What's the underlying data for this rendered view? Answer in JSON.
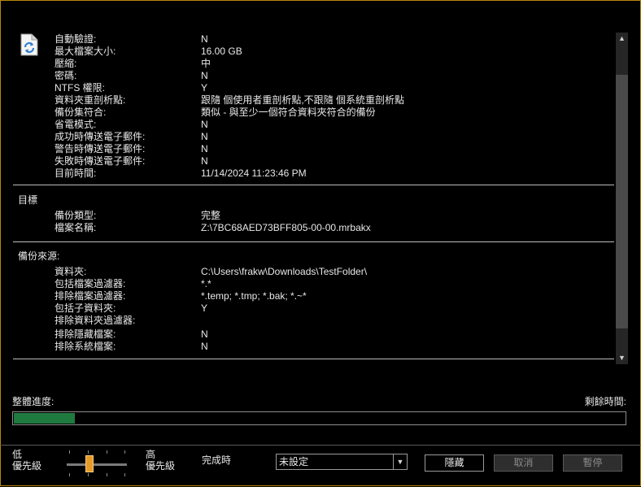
{
  "summary": [
    {
      "k": "自動驗證:",
      "v": "N"
    },
    {
      "k": "最大檔案大小:",
      "v": "16.00 GB"
    },
    {
      "k": "壓縮:",
      "v": "中"
    },
    {
      "k": "密碼:",
      "v": "N"
    },
    {
      "k": "NTFS 權限:",
      "v": "Y"
    },
    {
      "k": "資料夾重剖析點:",
      "v": "跟隨 個使用者重剖析點,不跟隨 個系統重剖析點"
    },
    {
      "k": "備份集符合:",
      "v": "類似 - 與至少一個符合資料夾符合的備份"
    },
    {
      "k": "省電模式:",
      "v": "N"
    },
    {
      "k": "成功時傳送電子郵件:",
      "v": "N"
    },
    {
      "k": "警告時傳送電子郵件:",
      "v": "N"
    },
    {
      "k": "失敗時傳送電子郵件:",
      "v": "N"
    },
    {
      "k": "目前時間:",
      "v": "11/14/2024 11:23:46 PM"
    }
  ],
  "target": {
    "title": "目標",
    "items": [
      {
        "k": "備份類型:",
        "v": "完整"
      },
      {
        "k": "檔案名稱:",
        "v": "Z:\\7BC68AED73BFF805-00-00.mrbakx"
      }
    ]
  },
  "source": {
    "title": "備份來源:",
    "items": [
      {
        "k": "資料夾:",
        "v": "C:\\Users\\frakw\\Downloads\\TestFolder\\"
      },
      {
        "k": "包括檔案過濾器:",
        "v": "*.*"
      },
      {
        "k": "排除檔案過濾器:",
        "v": "*.temp; *.tmp; *.bak; *.~*"
      },
      {
        "k": "包括子資料夾:",
        "v": "Y"
      },
      {
        "k": "排除資料夾過濾器:",
        "v": ""
      },
      {
        "k": "排除隱藏檔案:",
        "v": "N"
      },
      {
        "k": "排除系統檔案:",
        "v": "N"
      }
    ]
  },
  "progress": {
    "overall_label": "整體進度:",
    "remaining_label": "剩餘時間:",
    "fraction": 0.1,
    "fill_color": "#1f7a3f"
  },
  "priority": {
    "low_line1": "低",
    "low_line2": "優先級",
    "high_line1": "高",
    "high_line2": "優先級",
    "level_fraction": 0.36,
    "thumb_color": "#e59b2a"
  },
  "completion": {
    "label": "完成時",
    "selected": "未設定"
  },
  "buttons": {
    "hide": "隱藏",
    "cancel": "取消",
    "pause": "暫停"
  },
  "icons": {
    "document": "backup-document-icon",
    "scroll_up": "scroll-up-arrow-icon",
    "scroll_down": "scroll-down-arrow-icon",
    "dropdown": "chevron-down-icon"
  }
}
